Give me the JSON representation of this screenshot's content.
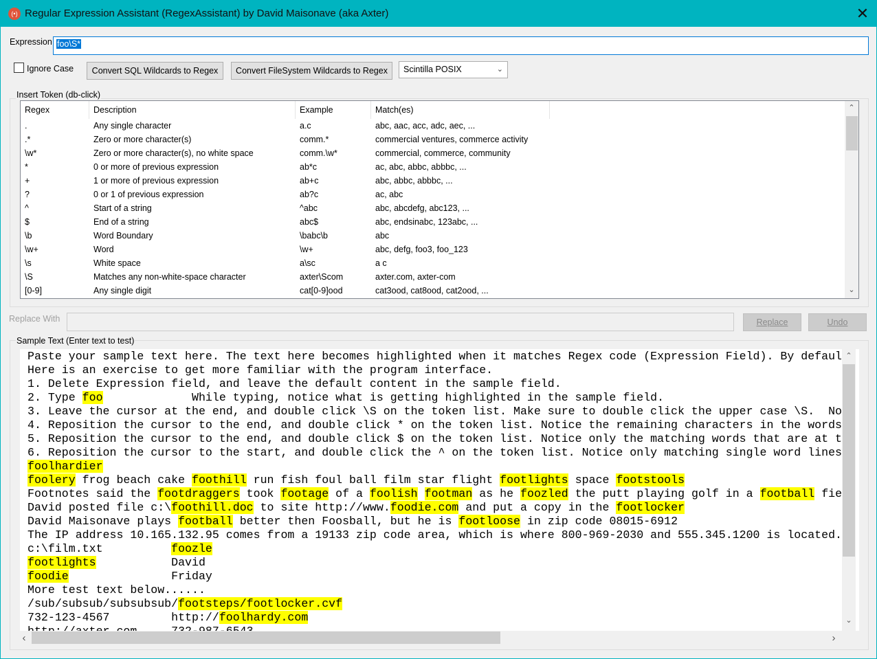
{
  "window": {
    "title": "Regular Expression Assistant (RegexAssistant) by David Maisonave (aka Axter)",
    "close": "✕",
    "app_icon": "app-icon",
    "accent": "#00b4c0"
  },
  "expression": {
    "label": "Expression",
    "value": "foo\\S*"
  },
  "options": {
    "ignore_case_label": "Ignore Case",
    "ignore_case_checked": false,
    "sql_button": "Convert SQL Wildcards to Regex",
    "fs_button": "Convert FileSystem Wildcards to Regex",
    "dialect": "Scintilla POSIX"
  },
  "tokens": {
    "label": "Insert Token (db-click)",
    "columns": [
      "Regex",
      "Description",
      "Example",
      "Match(es)"
    ],
    "rows": [
      [
        ".",
        "Any single character",
        "a.c",
        "abc, aac, acc, adc, aec, ..."
      ],
      [
        ".*",
        "Zero or more character(s)",
        "comm.*",
        "commercial ventures, commerce activity"
      ],
      [
        "\\w*",
        "Zero or more character(s), no white space",
        "comm.\\w*",
        "commercial, commerce, community"
      ],
      [
        "*",
        "0 or more of previous expression",
        "ab*c",
        "ac, abc, abbc, abbbc, ..."
      ],
      [
        "+",
        "1 or more of previous expression",
        "ab+c",
        "abc, abbc, abbbc, ..."
      ],
      [
        "?",
        "0 or 1 of previous expression",
        "ab?c",
        "ac, abc"
      ],
      [
        "^",
        "Start of a string",
        "^abc",
        "abc, abcdefg, abc123, ..."
      ],
      [
        "$",
        "End of a string",
        "abc$",
        "abc, endsinabc, 123abc, ..."
      ],
      [
        "\\b",
        "Word Boundary",
        "\\babc\\b",
        "abc"
      ],
      [
        "\\w+",
        "Word",
        "\\w+",
        "abc, defg, foo3, foo_123"
      ],
      [
        "\\s",
        "White space",
        "a\\sc",
        "a c"
      ],
      [
        "\\S",
        "Matches any non-white-space character",
        "axter\\Scom",
        "axter.com, axter-com"
      ],
      [
        "[0-9]",
        "Any single digit",
        "cat[0-9]ood",
        "cat3ood, cat8ood, cat2ood, ..."
      ]
    ]
  },
  "replace": {
    "label": "Replace With",
    "value": "",
    "replace_button": "Replace",
    "undo_button": "Undo"
  },
  "sample": {
    "label": "Sample Text (Enter text to test)",
    "highlight_color": "#ffff00",
    "lines": [
      [
        [
          "Paste your sample text here. The text here becomes highlighted when it matches Regex code (Expression Field). By defaul",
          0
        ]
      ],
      [
        [
          "Here is an exercise to get more familiar with the program interface.",
          0
        ]
      ],
      [
        [
          "1. Delete Expression field, and leave the default content in the sample field.",
          0
        ]
      ],
      [
        [
          "2. Type ",
          0
        ],
        [
          "foo",
          1
        ],
        [
          "             While typing, notice what is getting highlighted in the sample field.",
          0
        ]
      ],
      [
        [
          "3. Leave the cursor at the end, and double click \\S on the token list. Make sure to double click the upper case \\S.  No",
          0
        ]
      ],
      [
        [
          "4. Reposition the cursor to the end, and double click * on the token list. Notice the remaining characters in the words",
          0
        ]
      ],
      [
        [
          "5. Reposition the cursor to the end, and double click $ on the token list. Notice only the matching words that are at t",
          0
        ]
      ],
      [
        [
          "6. Reposition the cursor to the start, and double click the ^ on the token list. Notice only matching single word lines",
          0
        ]
      ],
      [
        [
          "foolhardier",
          1
        ]
      ],
      [
        [
          "foolery",
          1
        ],
        [
          " frog beach cake ",
          0
        ],
        [
          "foothill",
          1
        ],
        [
          " run fish foul ball film star flight ",
          0
        ],
        [
          "footlights",
          1
        ],
        [
          " space ",
          0
        ],
        [
          "footstools",
          1
        ]
      ],
      [
        [
          "Footnotes said the ",
          0
        ],
        [
          "footdraggers",
          1
        ],
        [
          " took ",
          0
        ],
        [
          "footage",
          1
        ],
        [
          " of a ",
          0
        ],
        [
          "foolish",
          1
        ],
        [
          " ",
          0
        ],
        [
          "footman",
          1
        ],
        [
          " as he ",
          0
        ],
        [
          "foozled",
          1
        ],
        [
          " the putt playing golf in a ",
          0
        ],
        [
          "football",
          1
        ],
        [
          " fie",
          0
        ]
      ],
      [
        [
          "David posted file c:\\",
          0
        ],
        [
          "foothill.doc",
          1
        ],
        [
          " to site http://www.",
          0
        ],
        [
          "foodie.com",
          1
        ],
        [
          " and put a copy in the ",
          0
        ],
        [
          "footlocker",
          1
        ]
      ],
      [
        [
          "David Maisonave plays ",
          0
        ],
        [
          "football",
          1
        ],
        [
          " better then Foosball, but he is ",
          0
        ],
        [
          "footloose",
          1
        ],
        [
          " in zip code 08015-6912",
          0
        ]
      ],
      [
        [
          "The IP address 10.165.132.95 comes from a 19133 zip code area, which is where 800-969-2030 and 555.345.1200 is located.",
          0
        ]
      ],
      [
        [
          "c:\\film.txt          ",
          0
        ],
        [
          "foozle",
          1
        ]
      ],
      [
        [
          "footlights",
          1
        ],
        [
          "           David",
          0
        ]
      ],
      [
        [
          "foodie",
          1
        ],
        [
          "               Friday",
          0
        ]
      ],
      [
        [
          "More test text below......",
          0
        ]
      ],
      [
        [
          "/sub/subsub/subsubsub/",
          0
        ],
        [
          "footsteps/footlocker.cvf",
          1
        ]
      ],
      [
        [
          "732-123-4567         http://",
          0
        ],
        [
          "foolhardy.com",
          1
        ]
      ],
      [
        [
          "http://axter.com     732-987-6543",
          0
        ]
      ]
    ]
  }
}
